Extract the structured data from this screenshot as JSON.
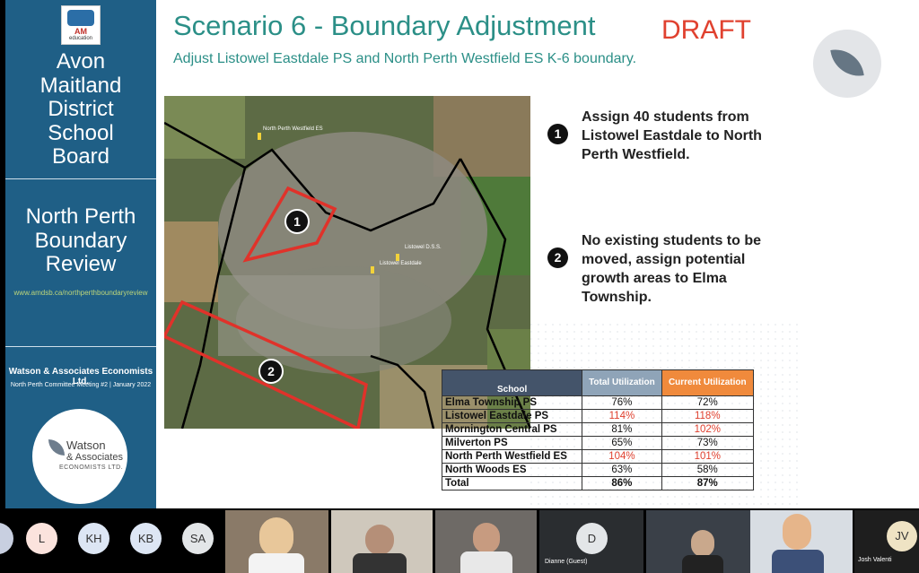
{
  "sidebar": {
    "logo_text": "education",
    "board_lines": [
      "Avon",
      "Maitland",
      "District",
      "School",
      "Board"
    ],
    "review_lines": [
      "North Perth",
      "Boundary",
      "Review"
    ],
    "url": "www.amdsb.ca/northperthboundaryreview",
    "consultant": "Watson & Associates Economists Ltd.",
    "meeting": "North Perth Committee Meeting #2  |  January 2022",
    "watson_logo": {
      "line1": "Watson",
      "line2": "& Associates",
      "line3": "ECONOMISTS LTD."
    }
  },
  "slide": {
    "title": "Scenario 6 - Boundary Adjustment",
    "draft": "DRAFT",
    "subtitle": "Adjust Listowel Eastdale PS and North Perth Westfield ES K-6 boundary.",
    "leaf_icon": "leaf-icon"
  },
  "map": {
    "labels": {
      "westfield": "North Perth Westfield ES",
      "dss": "Listowel D.S.S.",
      "eastdale": "Listowel Eastdale"
    },
    "markers": [
      "1",
      "2"
    ]
  },
  "points": [
    {
      "num": "1",
      "text": "Assign 40 students from Listowel Eastdale to North Perth Westfield."
    },
    {
      "num": "2",
      "text": "No existing students to be moved, assign potential growth areas to Elma Township."
    }
  ],
  "table": {
    "headers": {
      "school": "School",
      "total": "Total Utilization",
      "current": "Current Utilization"
    },
    "rows": [
      {
        "school": "Elma Township PS",
        "total": "76%",
        "current": "72%"
      },
      {
        "school": "Listowel Eastdale PS",
        "total": "114%",
        "current": "118%"
      },
      {
        "school": "Mornington Central PS",
        "total": "81%",
        "current": "102%"
      },
      {
        "school": "Milverton PS",
        "total": "65%",
        "current": "73%"
      },
      {
        "school": "North Perth Westfield ES",
        "total": "104%",
        "current": "101%"
      },
      {
        "school": "North Woods ES",
        "total": "63%",
        "current": "58%"
      },
      {
        "school": "Total",
        "total": "86%",
        "current": "87%"
      }
    ],
    "over_color": "#e0412f"
  },
  "participants": {
    "initials": [
      "L",
      "KH",
      "KB",
      "SA",
      "D",
      "JV"
    ],
    "names": [
      "Dianne (Guest)",
      "Josh Valenti"
    ]
  },
  "colors": {
    "sidebar": "#1f5f86",
    "accent": "#2b8f87",
    "draft": "#e0412f",
    "boundary": "#e0322a"
  }
}
